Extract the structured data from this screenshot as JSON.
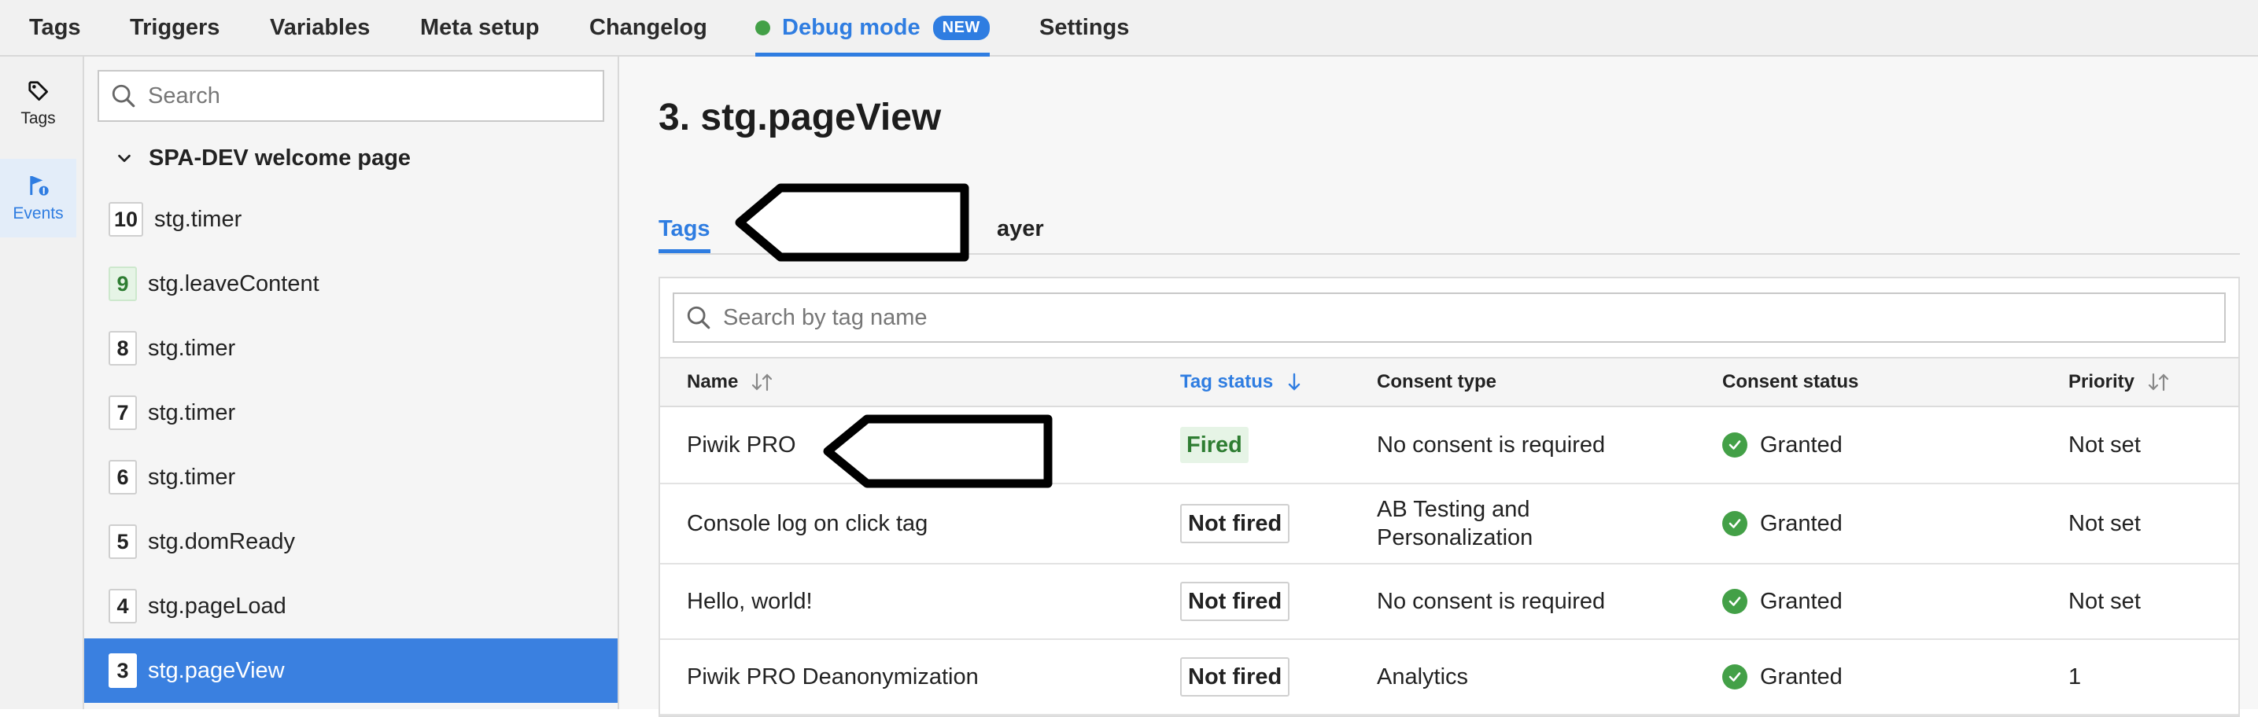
{
  "top_nav": {
    "tabs": [
      {
        "label": "Tags"
      },
      {
        "label": "Triggers"
      },
      {
        "label": "Variables"
      },
      {
        "label": "Meta setup"
      },
      {
        "label": "Changelog"
      },
      {
        "label": "Debug mode",
        "badge": "NEW",
        "active": true
      },
      {
        "label": "Settings"
      }
    ]
  },
  "rail": {
    "items": [
      {
        "label": "Tags",
        "icon": "tag-icon"
      },
      {
        "label": "Events",
        "icon": "flag-icon",
        "active": true
      }
    ]
  },
  "sidebar": {
    "search_placeholder": "Search",
    "group_title": "SPA-DEV welcome page",
    "events": [
      {
        "num": "10",
        "label": "stg.timer"
      },
      {
        "num": "9",
        "label": "stg.leaveContent"
      },
      {
        "num": "8",
        "label": "stg.timer"
      },
      {
        "num": "7",
        "label": "stg.timer"
      },
      {
        "num": "6",
        "label": "stg.timer"
      },
      {
        "num": "5",
        "label": "stg.domReady"
      },
      {
        "num": "4",
        "label": "stg.pageLoad"
      },
      {
        "num": "3",
        "label": "stg.pageView",
        "selected": true
      }
    ]
  },
  "main": {
    "title": "3. stg.pageView",
    "tabs": {
      "tags": "Tags",
      "partial": "ayer"
    },
    "tag_search_placeholder": "Search by tag name",
    "columns": {
      "name": "Name",
      "tag_status": "Tag status",
      "consent_type": "Consent type",
      "consent_status": "Consent status",
      "priority": "Priority"
    },
    "rows": [
      {
        "name": "Piwik PRO",
        "status": "Fired",
        "consent_type": [
          "No consent is required"
        ],
        "consent_status": "Granted",
        "priority": "Not set"
      },
      {
        "name": "Console log on click tag",
        "status": "Not fired",
        "consent_type": [
          "AB Testing and",
          "Personalization"
        ],
        "consent_status": "Granted",
        "priority": "Not set"
      },
      {
        "name": "Hello, world!",
        "status": "Not fired",
        "consent_type": [
          "No consent is required"
        ],
        "consent_status": "Granted",
        "priority": "Not set"
      },
      {
        "name": "Piwik PRO Deanonymization",
        "status": "Not fired",
        "consent_type": [
          "Analytics"
        ],
        "consent_status": "Granted",
        "priority": "1"
      }
    ]
  },
  "colors": {
    "accent": "#2f7de1",
    "success": "#43a047",
    "selected_row": "#3a80e0"
  }
}
